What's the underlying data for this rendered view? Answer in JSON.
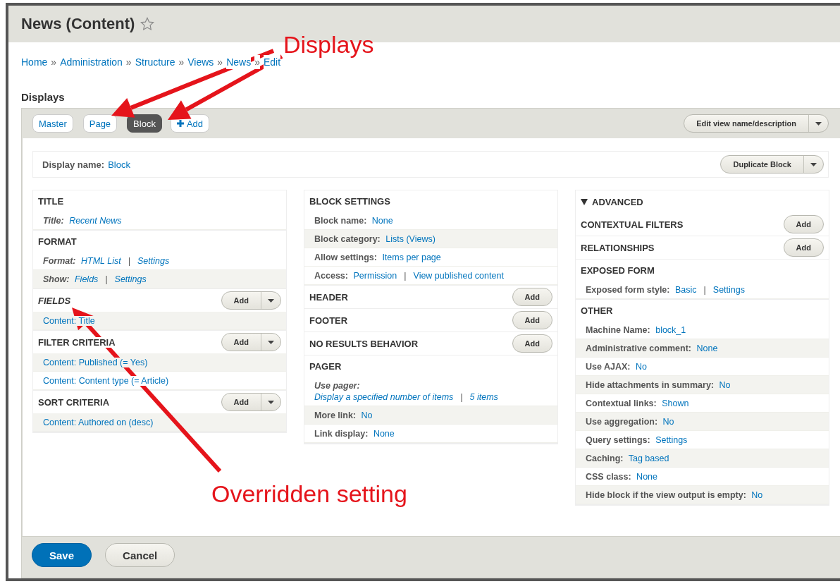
{
  "page": {
    "title": "News (Content)",
    "favorite": false
  },
  "breadcrumb": {
    "separator": "»",
    "items": [
      "Home",
      "Administration",
      "Structure",
      "Views",
      "News",
      "Edit"
    ]
  },
  "section_heading": "Displays",
  "display_tabs": [
    {
      "label": "Master",
      "kind": "tab",
      "selected": false
    },
    {
      "label": "Page",
      "kind": "tab",
      "selected": false
    },
    {
      "label": "Block",
      "kind": "tab",
      "selected": true
    },
    {
      "label": "Add",
      "kind": "add",
      "selected": false
    }
  ],
  "edit_view_button": "Edit view name/description",
  "display_name": {
    "label": "Display name:",
    "value": "Block"
  },
  "duplicate_button": "Duplicate Block",
  "link_separator": "|",
  "columns": [
    {
      "sections": [
        {
          "title": "TITLE",
          "overridden": false,
          "rows": [
            {
              "label": "Title:",
              "links": [
                "Recent News"
              ],
              "overridden": true,
              "shaded": false
            }
          ]
        },
        {
          "title": "FORMAT",
          "overridden": false,
          "rows": [
            {
              "label": "Format:",
              "links": [
                "HTML List",
                "Settings"
              ],
              "overridden": true,
              "shaded": false
            },
            {
              "label": "Show:",
              "links": [
                "Fields",
                "Settings"
              ],
              "overridden": true,
              "shaded": true
            }
          ]
        },
        {
          "title": "FIELDS",
          "overridden": true,
          "button": {
            "label": "Add",
            "kind": "split"
          },
          "rows": [
            {
              "links": [
                "Content: Title"
              ],
              "overridden": false,
              "shaded": true
            }
          ]
        },
        {
          "title": "FILTER CRITERIA",
          "overridden": false,
          "button": {
            "label": "Add",
            "kind": "split"
          },
          "rows": [
            {
              "links": [
                "Content: Published (= Yes)"
              ],
              "overridden": false,
              "shaded": true
            },
            {
              "links": [
                "Content: Content type (= Article)"
              ],
              "overridden": false,
              "shaded": false
            }
          ]
        },
        {
          "title": "SORT CRITERIA",
          "overridden": false,
          "button": {
            "label": "Add",
            "kind": "split"
          },
          "rows": [
            {
              "links": [
                "Content: Authored on (desc)"
              ],
              "overridden": false,
              "shaded": true
            }
          ]
        }
      ]
    },
    {
      "sections": [
        {
          "title": "BLOCK SETTINGS",
          "overridden": false,
          "rows": [
            {
              "label": "Block name:",
              "links": [
                "None"
              ],
              "overridden": false,
              "shaded": false
            },
            {
              "label": "Block category:",
              "links": [
                "Lists (Views)"
              ],
              "overridden": false,
              "shaded": true
            },
            {
              "label": "Allow settings:",
              "links": [
                "Items per page"
              ],
              "overridden": false,
              "shaded": false
            },
            {
              "label": "Access:",
              "links": [
                "Permission",
                "View published content"
              ],
              "overridden": false,
              "shaded": false
            }
          ]
        },
        {
          "title": "HEADER",
          "overridden": false,
          "button": {
            "label": "Add",
            "kind": "plain"
          }
        },
        {
          "title": "FOOTER",
          "overridden": false,
          "button": {
            "label": "Add",
            "kind": "plain"
          }
        },
        {
          "title": "NO RESULTS BEHAVIOR",
          "overridden": false,
          "button": {
            "label": "Add",
            "kind": "plain"
          }
        },
        {
          "title": "PAGER",
          "overridden": false,
          "rows": [
            {
              "label": "Use pager:",
              "links": [
                "Display a specified number of items",
                "5 items"
              ],
              "overridden": true,
              "shaded": false
            },
            {
              "label": "More link:",
              "links": [
                "No"
              ],
              "overridden": false,
              "shaded": true
            },
            {
              "label": "Link display:",
              "links": [
                "None"
              ],
              "overridden": false,
              "shaded": false
            }
          ]
        }
      ]
    },
    {
      "advanced": {
        "label": "ADVANCED",
        "expanded": true
      },
      "sections": [
        {
          "title": "CONTEXTUAL FILTERS",
          "overridden": false,
          "button": {
            "label": "Add",
            "kind": "plain"
          }
        },
        {
          "title": "RELATIONSHIPS",
          "overridden": false,
          "button": {
            "label": "Add",
            "kind": "plain"
          }
        },
        {
          "title": "EXPOSED FORM",
          "overridden": false,
          "rows": [
            {
              "label": "Exposed form style:",
              "links": [
                "Basic",
                "Settings"
              ],
              "overridden": false,
              "shaded": false
            }
          ]
        },
        {
          "title": "OTHER",
          "overridden": false,
          "rows": [
            {
              "label": "Machine Name:",
              "links": [
                "block_1"
              ],
              "overridden": false,
              "shaded": false
            },
            {
              "label": "Administrative comment:",
              "links": [
                "None"
              ],
              "overridden": false,
              "shaded": true
            },
            {
              "label": "Use AJAX:",
              "links": [
                "No"
              ],
              "overridden": false,
              "shaded": false
            },
            {
              "label": "Hide attachments in summary:",
              "links": [
                "No"
              ],
              "overridden": false,
              "shaded": true
            },
            {
              "label": "Contextual links:",
              "links": [
                "Shown"
              ],
              "overridden": false,
              "shaded": false
            },
            {
              "label": "Use aggregation:",
              "links": [
                "No"
              ],
              "overridden": false,
              "shaded": true
            },
            {
              "label": "Query settings:",
              "links": [
                "Settings"
              ],
              "overridden": false,
              "shaded": false
            },
            {
              "label": "Caching:",
              "links": [
                "Tag based"
              ],
              "overridden": false,
              "shaded": true
            },
            {
              "label": "CSS class:",
              "links": [
                "None"
              ],
              "overridden": false,
              "shaded": false
            },
            {
              "label": "Hide block if the view output is empty:",
              "links": [
                "No"
              ],
              "overridden": false,
              "shaded": true
            }
          ]
        }
      ]
    }
  ],
  "actions": [
    {
      "label": "Save",
      "kind": "primary"
    },
    {
      "label": "Cancel",
      "kind": "secondary"
    }
  ],
  "annotations": [
    {
      "text": "Displays"
    },
    {
      "text": "Overridden setting"
    }
  ]
}
